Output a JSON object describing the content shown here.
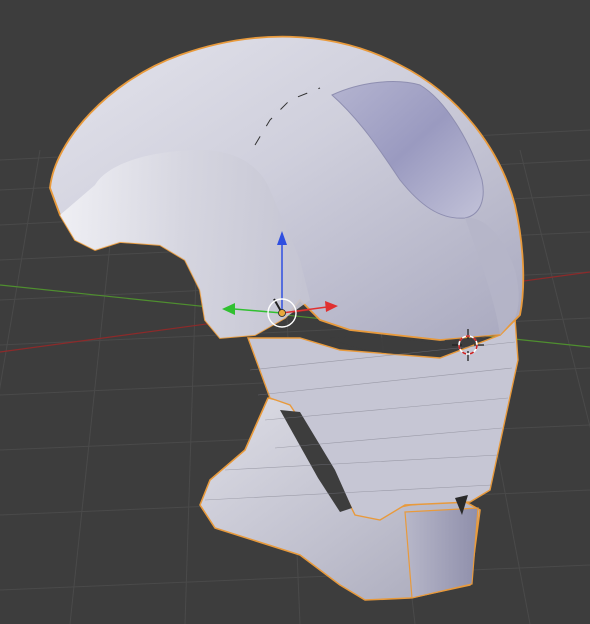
{
  "viewport": {
    "mode": "3d-viewport",
    "background_color": "#3d3d3d",
    "grid_color": "#4a4a4a",
    "x_axis_color": "#8c2a2a",
    "y_axis_color": "#4f8f2f"
  },
  "object": {
    "type": "helmet-mesh",
    "selected": true,
    "shading": "solid",
    "outline_color": "#e89a3c",
    "base_color": "#c9c9d6"
  },
  "manipulator": {
    "type": "translate",
    "x_color": "#e03030",
    "y_color": "#30c030",
    "z_color": "#2f4fe0",
    "center_color": "#e8a83c"
  },
  "cursor_3d": {
    "icon": "3d-cursor-icon",
    "ring_colors": [
      "#cc2222",
      "#ffffff"
    ]
  }
}
